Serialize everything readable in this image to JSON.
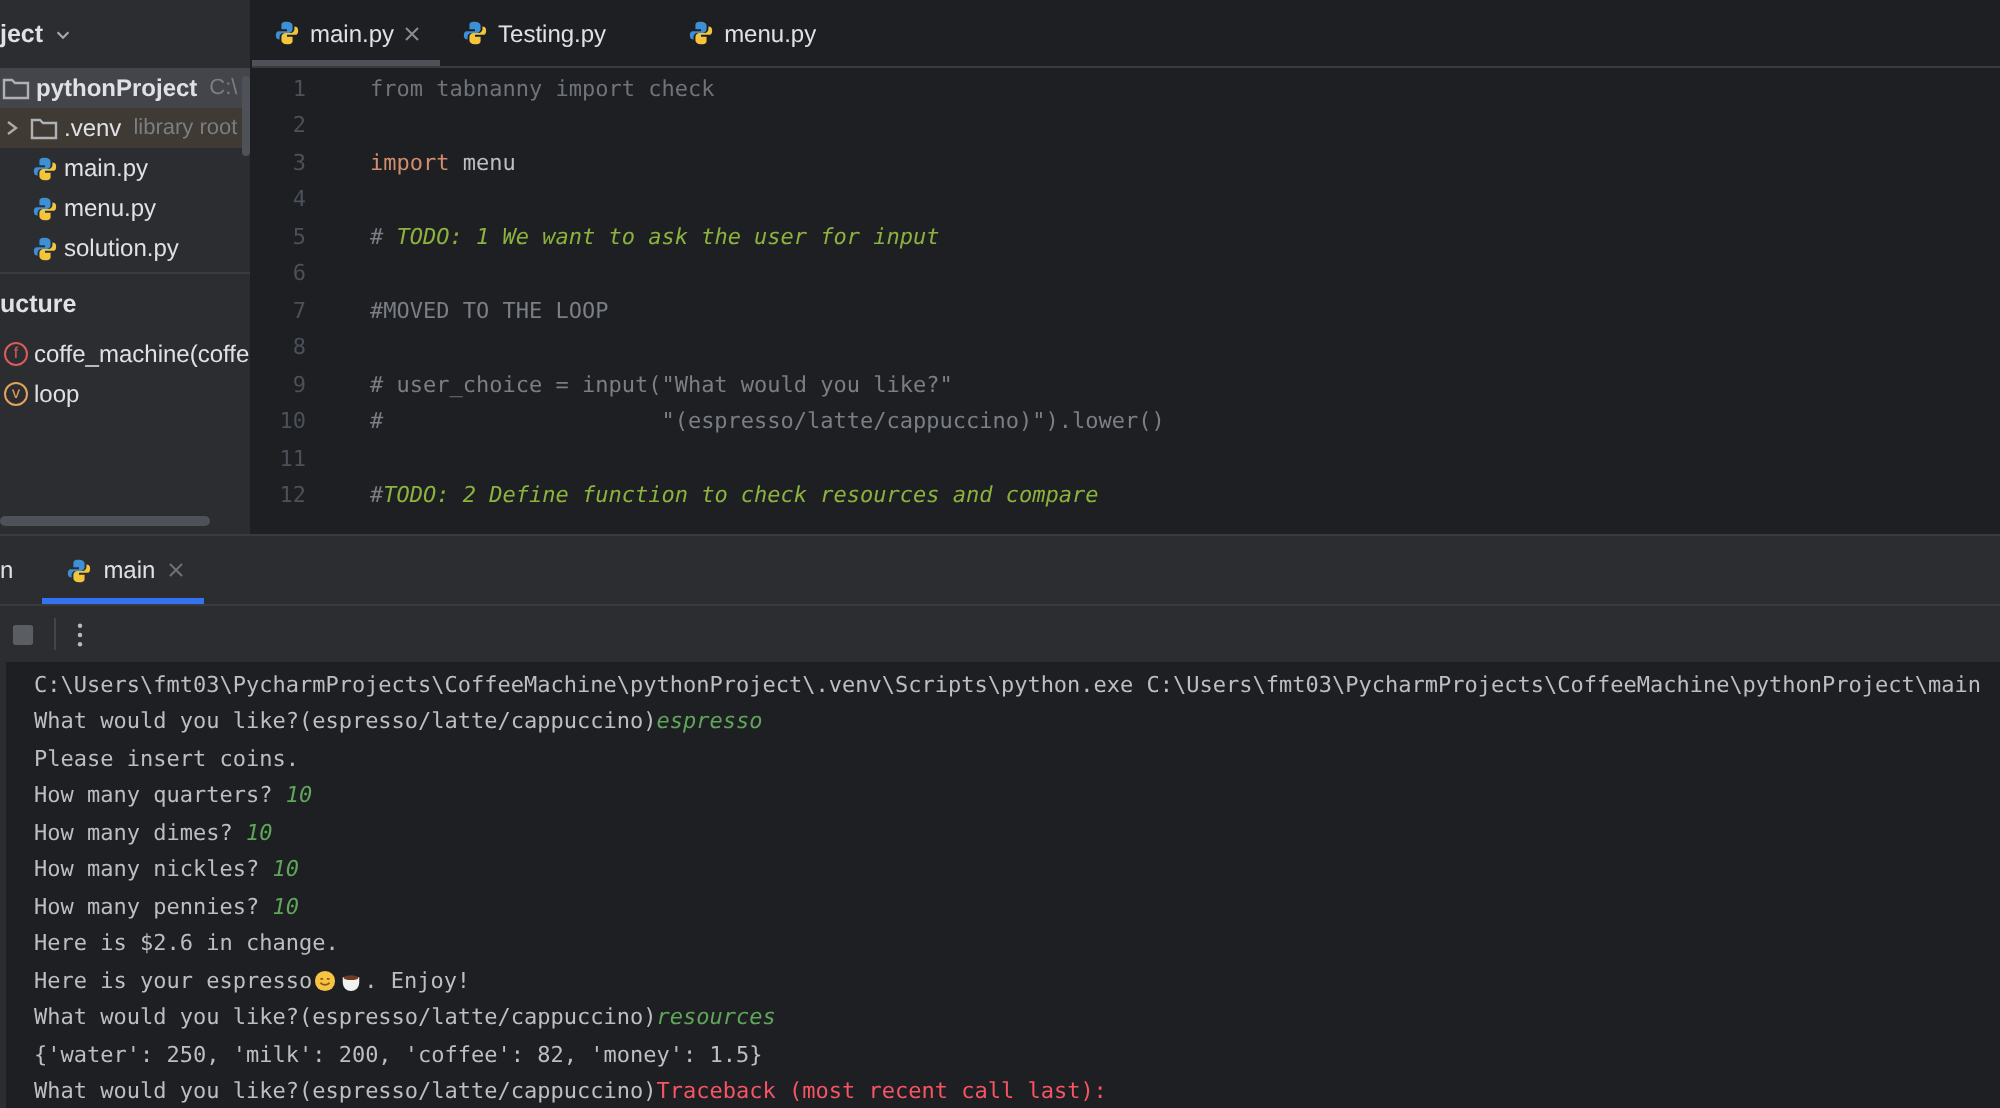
{
  "project_panel": {
    "title": "ject",
    "tree": [
      {
        "name": "pythonProject",
        "hint": "C:\\",
        "kind": "folder",
        "selected": true,
        "excluded": false,
        "children": [
          {
            "name": ".venv",
            "hint": "library root",
            "kind": "folder",
            "selected": false,
            "excluded": true,
            "expanded": false
          },
          {
            "name": "main.py",
            "kind": "python",
            "selected": false,
            "excluded": false
          },
          {
            "name": "menu.py",
            "kind": "python",
            "selected": false,
            "excluded": false
          },
          {
            "name": "solution.py",
            "kind": "python",
            "selected": false,
            "excluded": false
          }
        ]
      }
    ]
  },
  "structure_panel": {
    "title": "ucture",
    "items": [
      {
        "badge": "f",
        "name": "coffe_machine(coffe",
        "color": "#db5c5c"
      },
      {
        "badge": "v",
        "name": "loop",
        "color": "#e3a35c"
      }
    ]
  },
  "editor_tabs": [
    {
      "label": "main.py",
      "selected": true
    },
    {
      "label": "Testing.py",
      "selected": false
    },
    {
      "label": "menu.py",
      "selected": false
    }
  ],
  "code_lines": [
    {
      "number": "1",
      "parts": [
        {
          "kind": "unused",
          "text": "from tabnanny import check"
        }
      ]
    },
    {
      "number": "2"
    },
    {
      "number": "3",
      "parts": [
        {
          "kind": "keyword",
          "text": "import"
        },
        {
          "kind": "plain",
          "text": " menu"
        }
      ]
    },
    {
      "number": "4"
    },
    {
      "number": "5",
      "parts": [
        {
          "kind": "comment",
          "text": "# "
        },
        {
          "kind": "todo",
          "text": "TODO: 1 We want to ask the user for input"
        }
      ]
    },
    {
      "number": "6"
    },
    {
      "number": "7",
      "parts": [
        {
          "kind": "comment",
          "text": "#MOVED TO THE LOOP"
        }
      ]
    },
    {
      "number": "8"
    },
    {
      "number": "9",
      "parts": [
        {
          "kind": "comment",
          "text": "# user_choice = input(\"What would you like?\""
        }
      ]
    },
    {
      "number": "10",
      "parts": [
        {
          "kind": "comment",
          "text": "#                     \"(espresso/latte/cappuccino)\").lower()"
        }
      ]
    },
    {
      "number": "11"
    },
    {
      "number": "12",
      "parts": [
        {
          "kind": "comment",
          "text": "#"
        },
        {
          "kind": "todo",
          "text": "TODO: 2 Define function to check resources and compare"
        }
      ]
    }
  ],
  "run_tabs": [
    {
      "label": "n",
      "selected": false,
      "closable": false
    },
    {
      "label": "main",
      "selected": true,
      "closable": true
    }
  ],
  "console_lines": [
    [
      {
        "kind": "out",
        "text": "C:\\Users\\fmt03\\PycharmProjects\\CoffeeMachine\\pythonProject\\.venv\\Scripts\\python.exe C:\\Users\\fmt03\\PycharmProjects\\CoffeeMachine\\pythonProject\\main"
      }
    ],
    [
      {
        "kind": "out",
        "text": "What would you like?(espresso/latte/cappuccino)"
      },
      {
        "kind": "input",
        "text": "espresso"
      }
    ],
    [
      {
        "kind": "out",
        "text": "Please insert coins."
      }
    ],
    [
      {
        "kind": "out",
        "text": "How many quarters? "
      },
      {
        "kind": "input",
        "text": "10"
      }
    ],
    [
      {
        "kind": "out",
        "text": "How many dimes? "
      },
      {
        "kind": "input",
        "text": "10"
      }
    ],
    [
      {
        "kind": "out",
        "text": "How many nickles? "
      },
      {
        "kind": "input",
        "text": "10"
      }
    ],
    [
      {
        "kind": "out",
        "text": "How many pennies? "
      },
      {
        "kind": "input",
        "text": "10"
      }
    ],
    [
      {
        "kind": "out",
        "text": "Here is $2.6 in change."
      }
    ],
    [
      {
        "kind": "out",
        "text": "Here is your espresso"
      },
      {
        "kind": "emoji"
      },
      {
        "kind": "out",
        "text": ". Enjoy!"
      }
    ],
    [
      {
        "kind": "out",
        "text": "What would you like?(espresso/latte/cappuccino)"
      },
      {
        "kind": "input",
        "text": "resources"
      }
    ],
    [
      {
        "kind": "out",
        "text": "{'water': 250, 'milk': 200, 'coffee': 82, 'money': 1.5}"
      }
    ],
    [
      {
        "kind": "out",
        "text": "What would you like?(espresso/latte/cappuccino)"
      },
      {
        "kind": "error",
        "text": "Traceback (most recent call last):"
      }
    ]
  ]
}
